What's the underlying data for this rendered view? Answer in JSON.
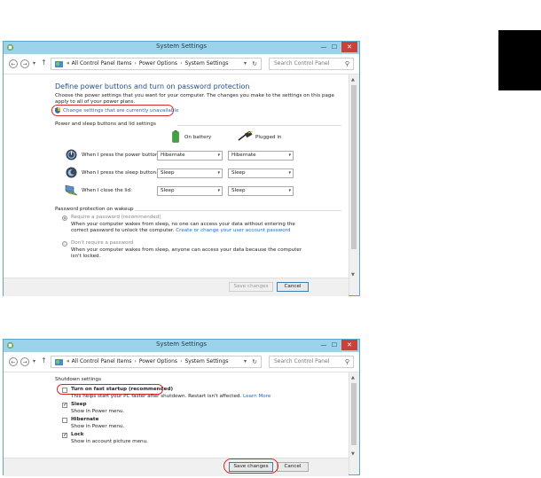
{
  "window_title": "System Settings",
  "breadcrumb": {
    "prefix": "«",
    "items": [
      "All Control Panel Items",
      "Power Options",
      "System Settings"
    ],
    "separator": "›"
  },
  "search_placeholder": "Search Control Panel",
  "window1": {
    "heading": "Define power buttons and turn on password protection",
    "description": "Choose the power settings that you want for your computer. The changes you make to the settings on this page apply to all of your power plans.",
    "change_link": "Change settings that are currently unavailable",
    "section_buttons": "Power and sleep buttons and lid settings",
    "col_battery": "On battery",
    "col_plugged": "Plugged in",
    "rows": [
      {
        "label": "When I press the power button:",
        "battery": "Hibernate",
        "plugged": "Hibernate"
      },
      {
        "label": "When I press the sleep button:",
        "battery": "Sleep",
        "plugged": "Sleep"
      },
      {
        "label": "When I close the lid:",
        "battery": "Sleep",
        "plugged": "Sleep"
      }
    ],
    "section_password": "Password protection on wakeup",
    "opt_require": "Require a password (recommended)",
    "opt_require_desc": "When your computer wakes from sleep, no one can access your data without entering the correct password to unlock the computer.",
    "opt_require_link": "Create or change your user account password",
    "opt_norequire": "Don't require a password",
    "opt_norequire_desc": "When your computer wakes from sleep, anyone can access your data because the computer isn't locked.",
    "save_button": "Save changes",
    "cancel_button": "Cancel"
  },
  "window2": {
    "section_shutdown": "Shutdown settings",
    "items": [
      {
        "label": "Turn on fast startup (recommended)",
        "desc": "This helps start your PC faster after shutdown. Restart isn't affected.",
        "link": "Learn More",
        "checked": false
      },
      {
        "label": "Sleep",
        "desc": "Show in Power menu.",
        "checked": true
      },
      {
        "label": "Hibernate",
        "desc": "Show in Power menu.",
        "checked": false
      },
      {
        "label": "Lock",
        "desc": "Show in account picture menu.",
        "checked": true
      }
    ],
    "save_button": "Save changes",
    "cancel_button": "Cancel"
  },
  "icons": {
    "back": "back-arrow-icon",
    "forward": "forward-arrow-icon",
    "up": "up-arrow-icon",
    "refresh": "refresh-icon",
    "search": "search-icon",
    "shield": "uac-shield-icon",
    "battery": "battery-icon",
    "plug": "plug-icon",
    "power": "power-button-icon",
    "sleep": "sleep-button-icon",
    "lid": "laptop-lid-icon",
    "control_panel": "control-panel-icon"
  },
  "colors": {
    "titlebar": "#9dd3ea",
    "close_button": "#c7423b",
    "heading": "#1e4e8c",
    "link": "#1f6bc5",
    "highlight_oval": "#d22b2b"
  }
}
